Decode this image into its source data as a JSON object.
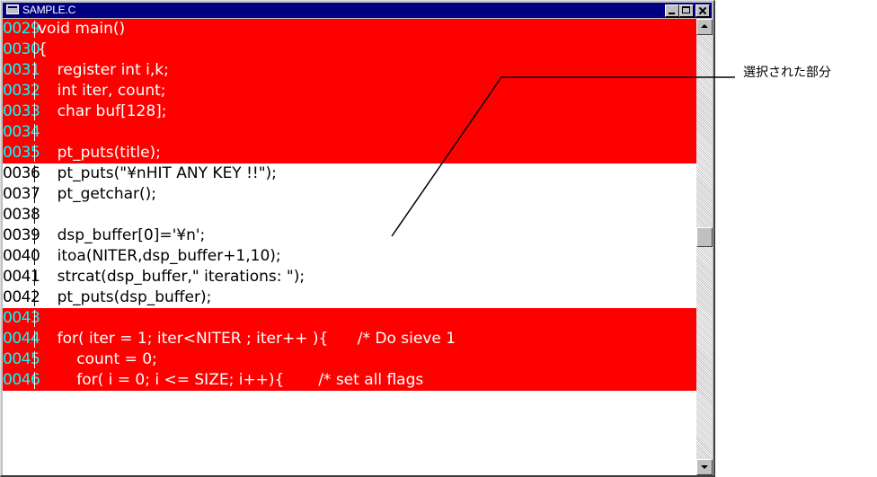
{
  "window": {
    "title": "SAMPLE.C"
  },
  "annotation": {
    "label": "選択された部分"
  },
  "lines": [
    {
      "num": "0029",
      "code": "void main()",
      "selected": true
    },
    {
      "num": "0030",
      "code": "{",
      "selected": true
    },
    {
      "num": "0031",
      "code": "    register int i,k;",
      "selected": true
    },
    {
      "num": "0032",
      "code": "    int iter, count;",
      "selected": true
    },
    {
      "num": "0033",
      "code": "    char buf[128];",
      "selected": true
    },
    {
      "num": "0034",
      "code": "",
      "selected": true
    },
    {
      "num": "0035",
      "code": "    pt_puts(title);",
      "selected": true
    },
    {
      "num": "0036",
      "code": "    pt_puts(\"¥nHIT ANY KEY !!\");",
      "selected": false
    },
    {
      "num": "0037",
      "code": "    pt_getchar();",
      "selected": false
    },
    {
      "num": "0038",
      "code": "",
      "selected": false
    },
    {
      "num": "0039",
      "code": "    dsp_buffer[0]='¥n';",
      "selected": false
    },
    {
      "num": "0040",
      "code": "    itoa(NITER,dsp_buffer+1,10);",
      "selected": false
    },
    {
      "num": "0041",
      "code": "    strcat(dsp_buffer,\" iterations: \");",
      "selected": false
    },
    {
      "num": "0042",
      "code": "    pt_puts(dsp_buffer);",
      "selected": false
    },
    {
      "num": "0043",
      "code": "",
      "selected": true
    },
    {
      "num": "0044",
      "code": "    for( iter = 1; iter<NITER ; iter++ ){      /* Do sieve 1",
      "selected": true
    },
    {
      "num": "0045",
      "code": "        count = 0;",
      "selected": true
    },
    {
      "num": "0046",
      "code": "        for( i = 0; i <= SIZE; i++){       /* set all flags",
      "selected": true
    }
  ],
  "icons": {
    "app": "document-icon",
    "minimize": "minimize-icon",
    "maximize": "maximize-icon",
    "close": "close-icon",
    "scroll_up": "scroll-up-arrow-icon",
    "scroll_down": "scroll-down-arrow-icon"
  },
  "colors": {
    "selection_bg": "#ff0000",
    "selection_fg": "#ffffff",
    "selected_line_number": "#00ffff",
    "titlebar": "#000080"
  }
}
